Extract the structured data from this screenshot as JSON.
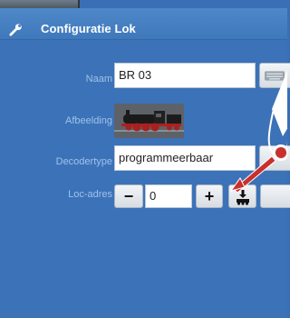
{
  "dialog": {
    "title": "Configuratie Lok"
  },
  "fields": {
    "naam_label": "Naam",
    "naam_value": "BR 03",
    "afbeelding_label": "Afbeelding",
    "decodertype_label": "Decodertype",
    "decodertype_value": "programmeerbaar",
    "locadres_label": "Loc-adres",
    "locadres_value": "0"
  },
  "controls": {
    "minus_symbol": "−",
    "plus_symbol": "+"
  },
  "icons": {
    "title": "wrench-icon",
    "naam_button": "keyboard-icon",
    "thumbnail": "locomotive-image",
    "program": "program-locomotive-icon"
  },
  "colors": {
    "panel_bg": "#3c72b8",
    "title_bg": "#4a84c5",
    "label_text": "#9fc3ea",
    "annotation_arrow": "#c9302c"
  }
}
